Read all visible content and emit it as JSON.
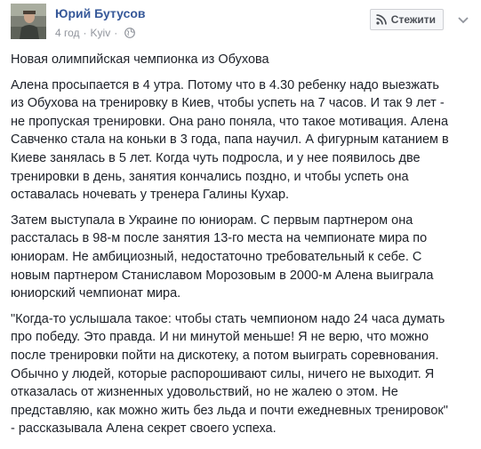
{
  "post": {
    "author_name": "Юрий Бутусов",
    "time": "4 год",
    "separator": "·",
    "location": "Kyiv",
    "separator2": "·",
    "privacy_icon": "globe-icon",
    "follow_button": {
      "label": "Стежити",
      "icon": "rss-icon"
    },
    "more_icon": "chevron-down-icon",
    "paragraphs": [
      {
        "lines": [
          "Новая олимпийская чемпионка из Обухова"
        ]
      },
      {
        "lines": [
          "Алена просыпается в 4 утра. Потому что в 4.30 ребенку надо выезжать",
          "из Обухова на тренировку в Киев, чтобы успеть на 7 часов. И так 9 лет -",
          "не пропуская тренировки. Она рано поняла, что такое мотивация. Алена",
          "Савченко стала на коньки в 3 года, папа научил. А фигурным катанием в",
          "Киеве занялась в 5 лет. Когда чуть подросла, и у нее появилось две",
          "тренировки в день, занятия кончались поздно, и чтобы успеть она",
          "оставалась ночевать у тренера Галины Кухар."
        ]
      },
      {
        "lines": [
          "Затем выступала в Украине по юниорам. С первым партнером она",
          "рассталась в 98-м после занятия 13-го места на чемпионате мира по",
          "юниорам. Не амбициозный, недостаточно требовательный к себе. С",
          "новым партнером Станиславом Морозовым в 2000-м Алена выиграла",
          "юниорский чемпионат мира."
        ]
      },
      {
        "lines": [
          "\"Когда-то услышала такое: чтобы стать чемпионом надо 24 часа думать",
          "про победу. Это правда. И ни минутой меньше! Я не верю, что можно",
          "после тренировки пойти на дискотеку, а потом выиграть соревнования.",
          "Обычно у людей, которые распорошивают силы, ничего не выходит. Я",
          "отказалась от жизненных удовольствий, но не жалею о этом. Не",
          "представляю, как можно жить без льда и почти ежедневных тренировок\"",
          "- рассказывала Алена секрет своего успеха."
        ]
      }
    ]
  },
  "colors": {
    "link": "#365899",
    "text": "#1d2129",
    "meta": "#90949c",
    "button_bg": "#f6f7f9",
    "button_border": "#ced0d4"
  }
}
